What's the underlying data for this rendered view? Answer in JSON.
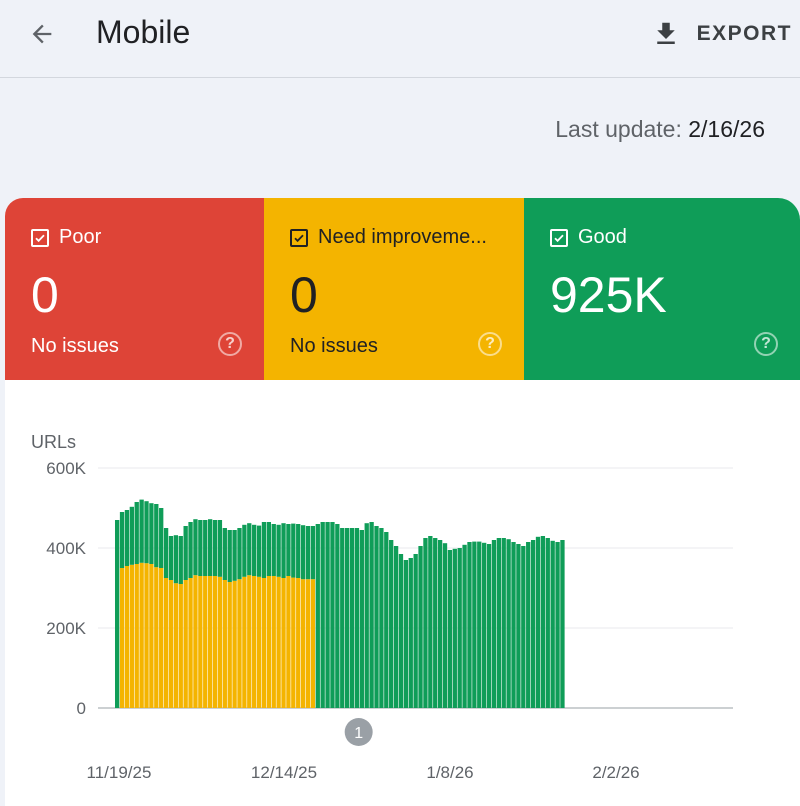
{
  "header": {
    "title": "Mobile",
    "back_icon": "arrow-back-icon",
    "export_label": "EXPORT",
    "export_icon": "download-icon"
  },
  "last_update": {
    "label": "Last update:",
    "date": "2/16/26"
  },
  "tiles": [
    {
      "label": "Poor",
      "value": "0",
      "sub": "No issues",
      "checked": true,
      "color": "#de4437"
    },
    {
      "label": "Need improveme...",
      "value": "0",
      "sub": "No issues",
      "checked": true,
      "color": "#f4b400"
    },
    {
      "label": "Good",
      "value": "925K",
      "sub": "",
      "checked": true,
      "color": "#0f9d58"
    }
  ],
  "colors": {
    "good": "#0f9d58",
    "need_improvement": "#f4b400",
    "poor": "#de4437",
    "annotation": "#9aa0a6"
  },
  "chart_data": {
    "type": "bar",
    "stacked": true,
    "ylabel": "URLs",
    "ylim": [
      0,
      600000
    ],
    "yticks": [
      "0",
      "200K",
      "400K",
      "600K"
    ],
    "xticks": [
      "11/19/25",
      "12/14/25",
      "1/8/26",
      "2/2/26"
    ],
    "annotation": {
      "label": "1",
      "bar_index": 50
    },
    "series": [
      {
        "name": "Need improvement",
        "color": "#f4b400",
        "values": [
          0,
          350000,
          355000,
          358000,
          360000,
          363000,
          362000,
          360000,
          352000,
          350000,
          325000,
          320000,
          312000,
          310000,
          320000,
          325000,
          332000,
          330000,
          330000,
          330000,
          330000,
          328000,
          320000,
          315000,
          318000,
          322000,
          328000,
          332000,
          330000,
          328000,
          325000,
          330000,
          330000,
          328000,
          325000,
          330000,
          326000,
          325000,
          322000,
          322000,
          322000,
          0,
          0,
          0,
          0,
          0,
          0,
          0,
          0,
          0,
          0,
          0,
          0,
          0,
          0,
          0,
          0,
          0,
          0,
          0,
          0,
          0,
          0,
          0,
          0,
          0,
          0,
          0,
          0,
          0,
          0,
          0,
          0,
          0,
          0,
          0,
          0,
          0,
          0,
          0,
          0,
          0,
          0,
          0,
          0,
          0,
          0,
          0,
          0,
          0,
          0,
          0,
          0,
          0,
          0,
          0,
          0,
          0,
          0,
          0,
          0,
          0,
          0,
          0,
          0,
          0,
          0,
          0,
          0,
          0,
          0,
          0,
          0,
          0,
          0,
          0,
          0,
          0,
          0,
          0,
          0,
          0
        ]
      },
      {
        "name": "Good",
        "color": "#0f9d58",
        "values": [
          470000,
          140000,
          140000,
          145000,
          155000,
          158000,
          155000,
          152000,
          158000,
          150000,
          125000,
          110000,
          120000,
          120000,
          135000,
          140000,
          140000,
          140000,
          140000,
          142000,
          140000,
          142000,
          130000,
          130000,
          127000,
          128000,
          130000,
          130000,
          128000,
          128000,
          140000,
          135000,
          130000,
          130000,
          137000,
          130000,
          135000,
          135000,
          135000,
          133000,
          133000,
          460000,
          465000,
          465000,
          465000,
          460000,
          450000,
          450000,
          450000,
          450000,
          445000,
          462000,
          465000,
          455000,
          450000,
          440000,
          420000,
          405000,
          385000,
          370000,
          375000,
          385000,
          405000,
          425000,
          430000,
          425000,
          420000,
          412000,
          395000,
          398000,
          400000,
          408000,
          415000,
          416000,
          416000,
          413000,
          410000,
          420000,
          425000,
          425000,
          422000,
          415000,
          410000,
          405000,
          415000,
          420000,
          428000,
          430000,
          425000,
          418000,
          415000,
          420000
        ]
      }
    ]
  }
}
